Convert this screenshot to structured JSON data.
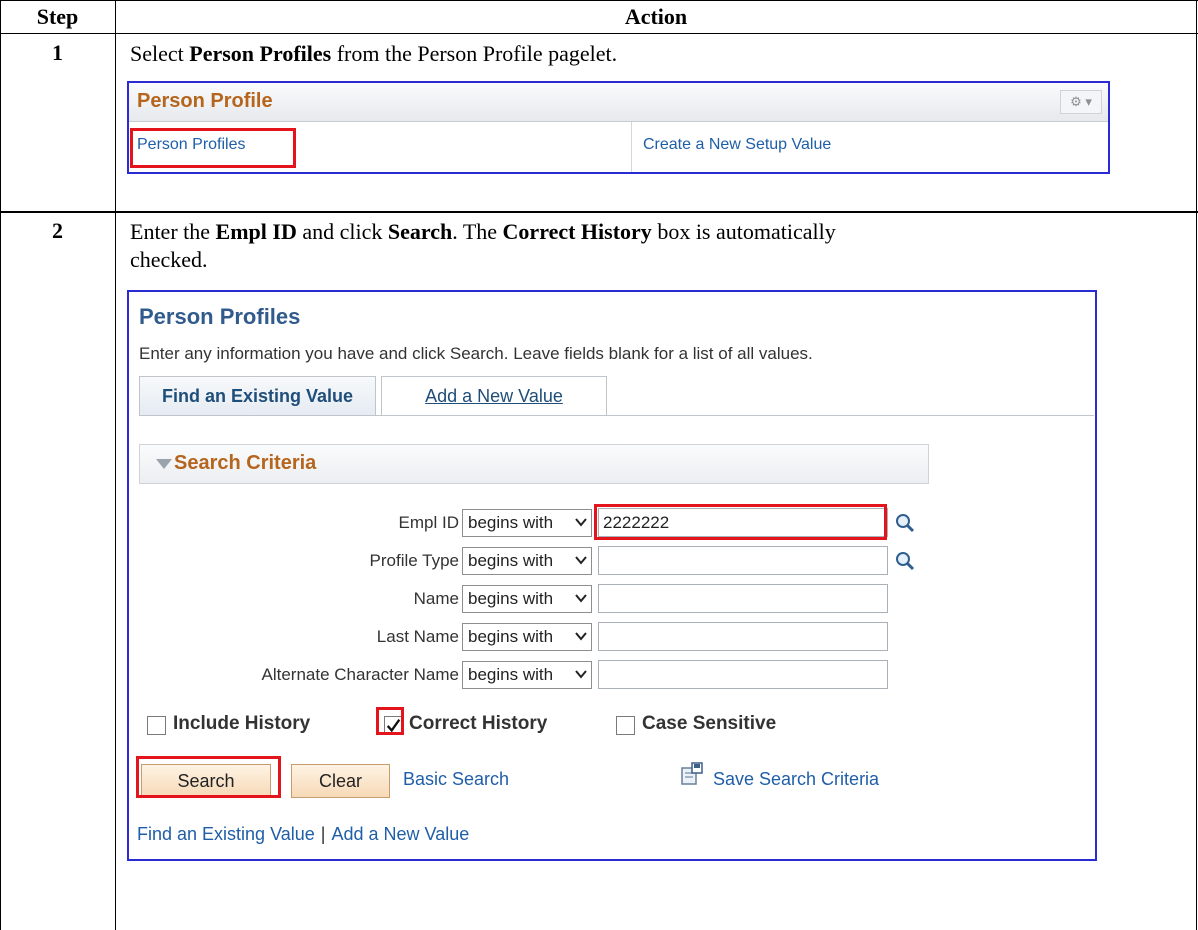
{
  "table": {
    "col_step": "Step",
    "col_action": "Action"
  },
  "steps": [
    {
      "num": "1",
      "text_pre": "Select ",
      "text_bold": "Person Profiles",
      "text_post": " from the Person Profile pagelet."
    },
    {
      "num": "2",
      "t1": "Enter the ",
      "b1": "Empl ID",
      "t2": " and click ",
      "b2": "Search",
      "t3": ". The ",
      "b3": "Correct History",
      "t4": " box is automatically",
      "t5": "checked."
    }
  ],
  "pagelet": {
    "title": "Person Profile",
    "menu_icon": "gear-icon",
    "link1": "Person Profiles",
    "link2": "Create a New Setup Value"
  },
  "search": {
    "title": "Person Profiles",
    "description": "Enter any information you have and click Search. Leave fields blank for a list of all values.",
    "tabs": [
      {
        "label": "Find an Existing Value",
        "active": true
      },
      {
        "label": "Add a New Value",
        "active": false
      }
    ],
    "criteria_title": "Search Criteria",
    "fields": [
      {
        "label": "Empl ID",
        "operator": "begins with",
        "value": "2222222",
        "lookup": true
      },
      {
        "label": "Profile Type",
        "operator": "begins with",
        "value": "",
        "lookup": true
      },
      {
        "label": "Name",
        "operator": "begins with",
        "value": "",
        "lookup": false
      },
      {
        "label": "Last Name",
        "operator": "begins with",
        "value": "",
        "lookup": false
      },
      {
        "label": "Alternate Character Name",
        "operator": "begins with",
        "value": "",
        "lookup": false
      }
    ],
    "checkboxes": [
      {
        "label": "Include History",
        "checked": false
      },
      {
        "label": "Correct History",
        "checked": true
      },
      {
        "label": "Case Sensitive",
        "checked": false
      }
    ],
    "buttons": {
      "search": "Search",
      "clear": "Clear"
    },
    "links": {
      "basic_search": "Basic Search",
      "save_search": "Save Search Criteria"
    },
    "footer": {
      "find": "Find an Existing Value",
      "add": "Add a New Value"
    }
  },
  "colors": {
    "highlight": "#e3141c",
    "frame": "#2b2bd6",
    "section_title": "#b5651d",
    "link": "#1f5ea8"
  }
}
